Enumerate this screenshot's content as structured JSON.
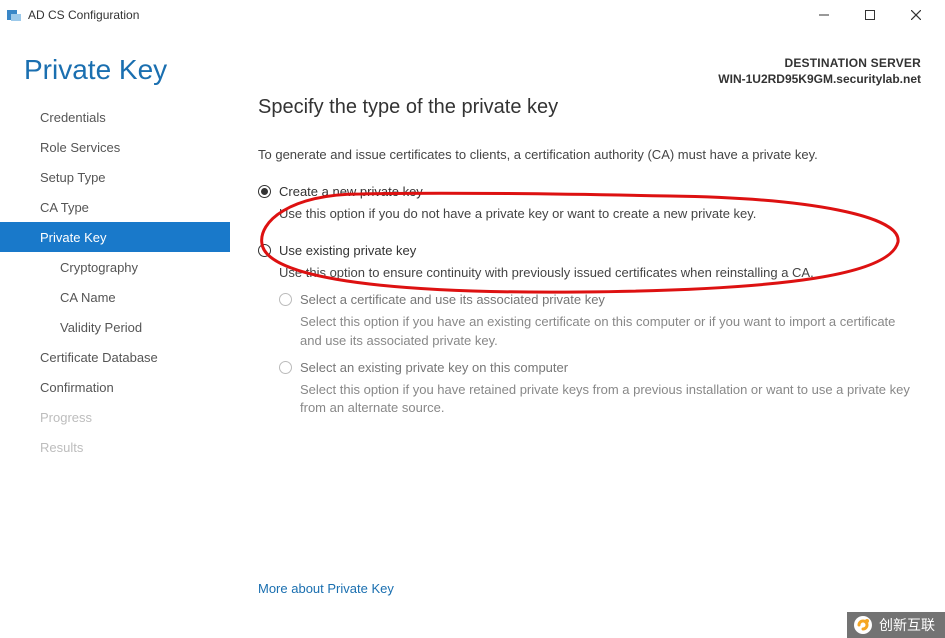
{
  "window": {
    "title": "AD CS Configuration"
  },
  "header": {
    "page_title": "Private Key",
    "destination_label": "DESTINATION SERVER",
    "destination_value": "WIN-1U2RD95K9GM.securitylab.net"
  },
  "sidebar": {
    "items": [
      {
        "label": "Credentials",
        "selected": false,
        "disabled": false,
        "indent": 0
      },
      {
        "label": "Role Services",
        "selected": false,
        "disabled": false,
        "indent": 0
      },
      {
        "label": "Setup Type",
        "selected": false,
        "disabled": false,
        "indent": 0
      },
      {
        "label": "CA Type",
        "selected": false,
        "disabled": false,
        "indent": 0
      },
      {
        "label": "Private Key",
        "selected": true,
        "disabled": false,
        "indent": 0
      },
      {
        "label": "Cryptography",
        "selected": false,
        "disabled": false,
        "indent": 1
      },
      {
        "label": "CA Name",
        "selected": false,
        "disabled": false,
        "indent": 1
      },
      {
        "label": "Validity Period",
        "selected": false,
        "disabled": false,
        "indent": 1
      },
      {
        "label": "Certificate Database",
        "selected": false,
        "disabled": false,
        "indent": 0
      },
      {
        "label": "Confirmation",
        "selected": false,
        "disabled": false,
        "indent": 0
      },
      {
        "label": "Progress",
        "selected": false,
        "disabled": true,
        "indent": 0
      },
      {
        "label": "Results",
        "selected": false,
        "disabled": true,
        "indent": 0
      }
    ]
  },
  "main": {
    "heading": "Specify the type of the private key",
    "intro": "To generate and issue certificates to clients, a certification authority (CA) must have a private key.",
    "option_create": {
      "label": "Create a new private key",
      "desc": "Use this option if you do not have a private key or want to create a new private key.",
      "selected": true
    },
    "option_existing": {
      "label": "Use existing private key",
      "desc": "Use this option to ensure continuity with previously issued certificates when reinstalling a CA.",
      "selected": false,
      "sub_cert": {
        "label": "Select a certificate and use its associated private key",
        "desc": "Select this option if you have an existing certificate on this computer or if you want to import a certificate and use its associated private key."
      },
      "sub_key": {
        "label": "Select an existing private key on this computer",
        "desc": "Select this option if you have retained private keys from a previous installation or want to use a private key from an alternate source."
      }
    },
    "more_link": "More about Private Key"
  },
  "watermark": {
    "text": "创新互联"
  }
}
